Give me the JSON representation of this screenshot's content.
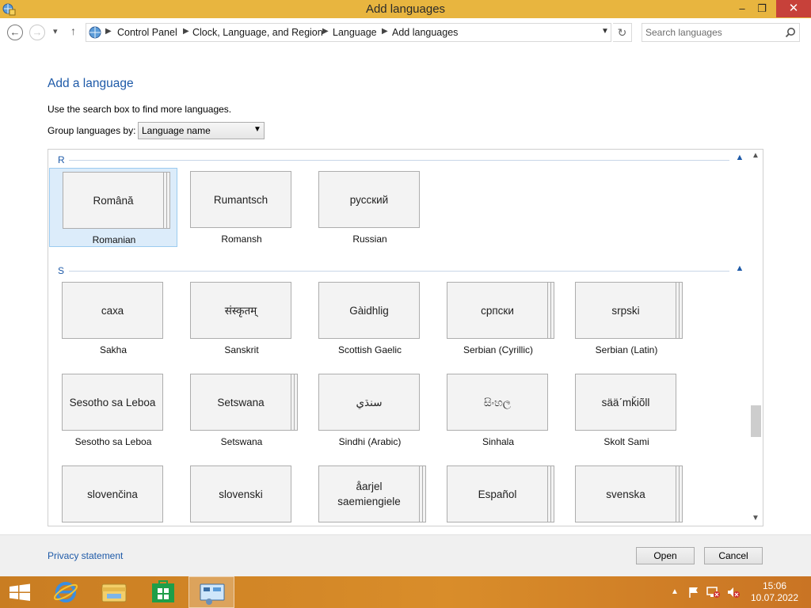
{
  "window": {
    "title": "Add languages",
    "minimize_glyph": "–",
    "restore_glyph": "❐",
    "close_glyph": "✕"
  },
  "address_bar": {
    "breadcrumbs": [
      "Control Panel",
      "Clock, Language, and Region",
      "Language",
      "Add languages"
    ],
    "search_placeholder": "Search languages"
  },
  "main": {
    "heading": "Add a language",
    "hint": "Use the search box to find more languages.",
    "group_by_label": "Group languages by:",
    "group_by_value": "Language name"
  },
  "groups": [
    {
      "letter": "R",
      "items": [
        {
          "native": "Română",
          "english": "Romanian",
          "selected": true,
          "stacked": true
        },
        {
          "native": "Rumantsch",
          "english": "Romansh",
          "selected": false,
          "stacked": false
        },
        {
          "native": "русский",
          "english": "Russian",
          "selected": false,
          "stacked": false
        }
      ]
    },
    {
      "letter": "S",
      "items": [
        {
          "native": "саха",
          "english": "Sakha",
          "selected": false,
          "stacked": false
        },
        {
          "native": "संस्कृतम्",
          "english": "Sanskrit",
          "selected": false,
          "stacked": false
        },
        {
          "native": "Gàidhlig",
          "english": "Scottish Gaelic",
          "selected": false,
          "stacked": false
        },
        {
          "native": "српски",
          "english": "Serbian (Cyrillic)",
          "selected": false,
          "stacked": true
        },
        {
          "native": "srpski",
          "english": "Serbian (Latin)",
          "selected": false,
          "stacked": true
        },
        {
          "native": "Sesotho sa Leboa",
          "english": "Sesotho sa Leboa",
          "selected": false,
          "stacked": false
        },
        {
          "native": "Setswana",
          "english": "Setswana",
          "selected": false,
          "stacked": true
        },
        {
          "native": "سنڌي",
          "english": "Sindhi (Arabic)",
          "selected": false,
          "stacked": false
        },
        {
          "native": "සිංහල",
          "english": "Sinhala",
          "selected": false,
          "stacked": false
        },
        {
          "native": "sääˊmǩiõll",
          "english": "Skolt Sami",
          "selected": false,
          "stacked": false
        },
        {
          "native": "slovenčina",
          "english": "",
          "selected": false,
          "stacked": false
        },
        {
          "native": "slovenski",
          "english": "",
          "selected": false,
          "stacked": false
        },
        {
          "native": "åarjel saemiengiele",
          "english": "",
          "selected": false,
          "stacked": true
        },
        {
          "native": "Español",
          "english": "",
          "selected": false,
          "stacked": true
        },
        {
          "native": "svenska",
          "english": "",
          "selected": false,
          "stacked": true
        }
      ]
    }
  ],
  "footer": {
    "privacy_link": "Privacy statement",
    "open_label": "Open",
    "cancel_label": "Cancel"
  },
  "taskbar": {
    "clock_time": "15:06",
    "clock_date": "10.07.2022",
    "items": [
      "start-button",
      "internet-explorer",
      "file-explorer",
      "store",
      "control-panel"
    ],
    "colors": {
      "accent": "#e8b53f",
      "taskbar": "#d98d2a",
      "link": "#1e5aa8"
    }
  }
}
